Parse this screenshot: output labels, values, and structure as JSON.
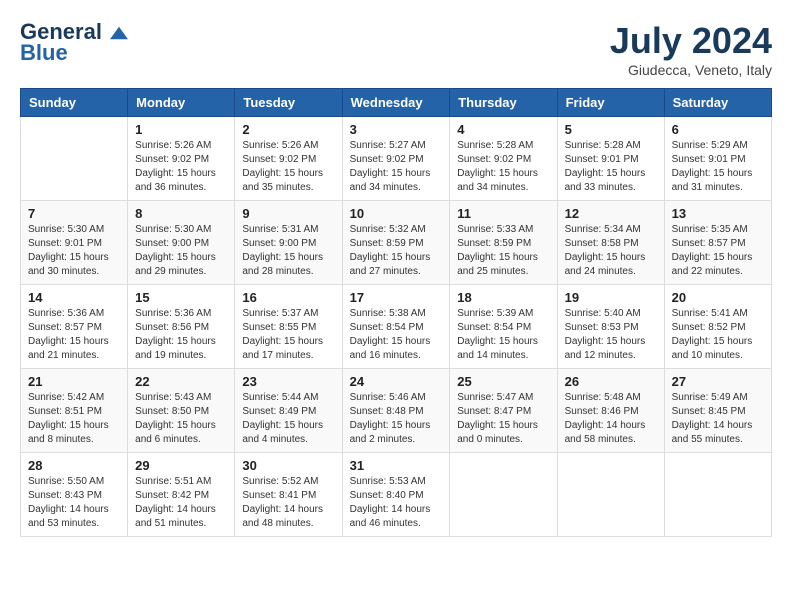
{
  "logo": {
    "line1": "General",
    "line2": "Blue",
    "tagline": ""
  },
  "header": {
    "month_year": "July 2024",
    "location": "Giudecca, Veneto, Italy"
  },
  "days_of_week": [
    "Sunday",
    "Monday",
    "Tuesday",
    "Wednesday",
    "Thursday",
    "Friday",
    "Saturday"
  ],
  "weeks": [
    [
      {
        "day": "",
        "content": ""
      },
      {
        "day": "1",
        "content": "Sunrise: 5:26 AM\nSunset: 9:02 PM\nDaylight: 15 hours\nand 36 minutes."
      },
      {
        "day": "2",
        "content": "Sunrise: 5:26 AM\nSunset: 9:02 PM\nDaylight: 15 hours\nand 35 minutes."
      },
      {
        "day": "3",
        "content": "Sunrise: 5:27 AM\nSunset: 9:02 PM\nDaylight: 15 hours\nand 34 minutes."
      },
      {
        "day": "4",
        "content": "Sunrise: 5:28 AM\nSunset: 9:02 PM\nDaylight: 15 hours\nand 34 minutes."
      },
      {
        "day": "5",
        "content": "Sunrise: 5:28 AM\nSunset: 9:01 PM\nDaylight: 15 hours\nand 33 minutes."
      },
      {
        "day": "6",
        "content": "Sunrise: 5:29 AM\nSunset: 9:01 PM\nDaylight: 15 hours\nand 31 minutes."
      }
    ],
    [
      {
        "day": "7",
        "content": "Sunrise: 5:30 AM\nSunset: 9:01 PM\nDaylight: 15 hours\nand 30 minutes."
      },
      {
        "day": "8",
        "content": "Sunrise: 5:30 AM\nSunset: 9:00 PM\nDaylight: 15 hours\nand 29 minutes."
      },
      {
        "day": "9",
        "content": "Sunrise: 5:31 AM\nSunset: 9:00 PM\nDaylight: 15 hours\nand 28 minutes."
      },
      {
        "day": "10",
        "content": "Sunrise: 5:32 AM\nSunset: 8:59 PM\nDaylight: 15 hours\nand 27 minutes."
      },
      {
        "day": "11",
        "content": "Sunrise: 5:33 AM\nSunset: 8:59 PM\nDaylight: 15 hours\nand 25 minutes."
      },
      {
        "day": "12",
        "content": "Sunrise: 5:34 AM\nSunset: 8:58 PM\nDaylight: 15 hours\nand 24 minutes."
      },
      {
        "day": "13",
        "content": "Sunrise: 5:35 AM\nSunset: 8:57 PM\nDaylight: 15 hours\nand 22 minutes."
      }
    ],
    [
      {
        "day": "14",
        "content": "Sunrise: 5:36 AM\nSunset: 8:57 PM\nDaylight: 15 hours\nand 21 minutes."
      },
      {
        "day": "15",
        "content": "Sunrise: 5:36 AM\nSunset: 8:56 PM\nDaylight: 15 hours\nand 19 minutes."
      },
      {
        "day": "16",
        "content": "Sunrise: 5:37 AM\nSunset: 8:55 PM\nDaylight: 15 hours\nand 17 minutes."
      },
      {
        "day": "17",
        "content": "Sunrise: 5:38 AM\nSunset: 8:54 PM\nDaylight: 15 hours\nand 16 minutes."
      },
      {
        "day": "18",
        "content": "Sunrise: 5:39 AM\nSunset: 8:54 PM\nDaylight: 15 hours\nand 14 minutes."
      },
      {
        "day": "19",
        "content": "Sunrise: 5:40 AM\nSunset: 8:53 PM\nDaylight: 15 hours\nand 12 minutes."
      },
      {
        "day": "20",
        "content": "Sunrise: 5:41 AM\nSunset: 8:52 PM\nDaylight: 15 hours\nand 10 minutes."
      }
    ],
    [
      {
        "day": "21",
        "content": "Sunrise: 5:42 AM\nSunset: 8:51 PM\nDaylight: 15 hours\nand 8 minutes."
      },
      {
        "day": "22",
        "content": "Sunrise: 5:43 AM\nSunset: 8:50 PM\nDaylight: 15 hours\nand 6 minutes."
      },
      {
        "day": "23",
        "content": "Sunrise: 5:44 AM\nSunset: 8:49 PM\nDaylight: 15 hours\nand 4 minutes."
      },
      {
        "day": "24",
        "content": "Sunrise: 5:46 AM\nSunset: 8:48 PM\nDaylight: 15 hours\nand 2 minutes."
      },
      {
        "day": "25",
        "content": "Sunrise: 5:47 AM\nSunset: 8:47 PM\nDaylight: 15 hours\nand 0 minutes."
      },
      {
        "day": "26",
        "content": "Sunrise: 5:48 AM\nSunset: 8:46 PM\nDaylight: 14 hours\nand 58 minutes."
      },
      {
        "day": "27",
        "content": "Sunrise: 5:49 AM\nSunset: 8:45 PM\nDaylight: 14 hours\nand 55 minutes."
      }
    ],
    [
      {
        "day": "28",
        "content": "Sunrise: 5:50 AM\nSunset: 8:43 PM\nDaylight: 14 hours\nand 53 minutes."
      },
      {
        "day": "29",
        "content": "Sunrise: 5:51 AM\nSunset: 8:42 PM\nDaylight: 14 hours\nand 51 minutes."
      },
      {
        "day": "30",
        "content": "Sunrise: 5:52 AM\nSunset: 8:41 PM\nDaylight: 14 hours\nand 48 minutes."
      },
      {
        "day": "31",
        "content": "Sunrise: 5:53 AM\nSunset: 8:40 PM\nDaylight: 14 hours\nand 46 minutes."
      },
      {
        "day": "",
        "content": ""
      },
      {
        "day": "",
        "content": ""
      },
      {
        "day": "",
        "content": ""
      }
    ]
  ]
}
